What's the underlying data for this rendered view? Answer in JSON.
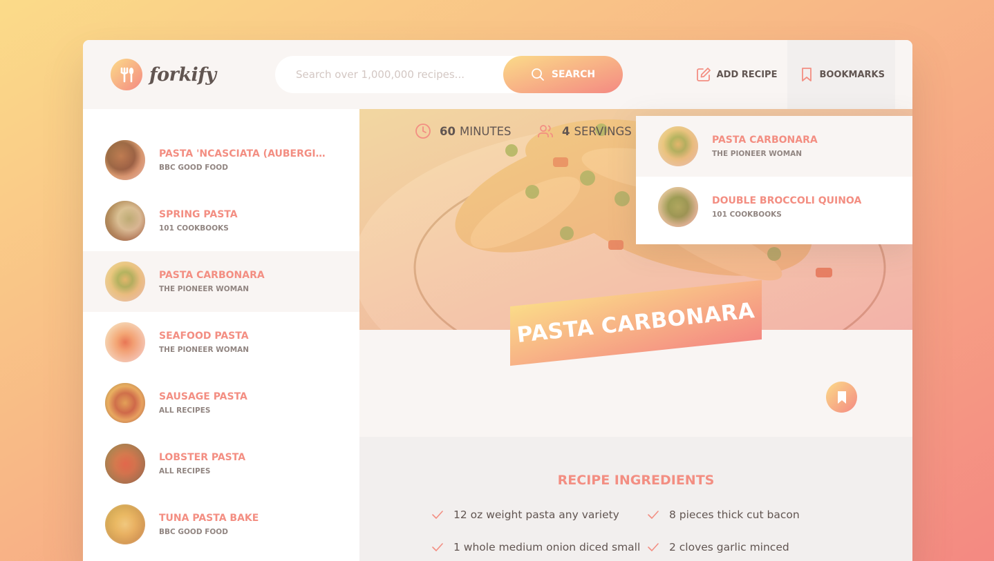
{
  "header": {
    "logo_text": "forkify",
    "search_placeholder": "Search over 1,000,000 recipes...",
    "search_label": "SEARCH",
    "add_recipe_label": "ADD RECIPE",
    "bookmarks_label": "BOOKMARKS"
  },
  "results": [
    {
      "title": "PASTA 'NCASCIATA (AUBERGINE ...",
      "publisher": "BBC GOOD FOOD",
      "active": false
    },
    {
      "title": "SPRING PASTA",
      "publisher": "101 COOKBOOKS",
      "active": false
    },
    {
      "title": "PASTA CARBONARA",
      "publisher": "THE PIONEER WOMAN",
      "active": true
    },
    {
      "title": "SEAFOOD PASTA",
      "publisher": "THE PIONEER WOMAN",
      "active": false
    },
    {
      "title": "SAUSAGE PASTA",
      "publisher": "ALL RECIPES",
      "active": false
    },
    {
      "title": "LOBSTER PASTA",
      "publisher": "ALL RECIPES",
      "active": false
    },
    {
      "title": "TUNA PASTA BAKE",
      "publisher": "BBC GOOD FOOD",
      "active": false
    }
  ],
  "bookmarks": [
    {
      "title": "PASTA CARBONARA",
      "publisher": "THE PIONEER WOMAN"
    },
    {
      "title": "DOUBLE BROCCOLI QUINOA",
      "publisher": "101 COOKBOOKS"
    }
  ],
  "recipe": {
    "title": "PASTA CARBONARA",
    "minutes": "60",
    "minutes_label": "MINUTES",
    "servings": "4",
    "servings_label": "SERVINGS",
    "ingredients_heading": "RECIPE INGREDIENTS",
    "ingredients": [
      "12 oz weight pasta any variety",
      "8 pieces thick cut bacon",
      "1 whole medium onion diced small",
      "2 cloves garlic minced"
    ]
  },
  "colors": {
    "accent": "#f38e82",
    "gradient_start": "#fbdb89",
    "gradient_end": "#f48982",
    "text": "#615551"
  },
  "icons": {
    "logo": "fork-spoon-icon",
    "search": "search-icon",
    "add_recipe": "edit-icon",
    "bookmarks": "bookmark-icon",
    "time": "clock-icon",
    "servings": "users-icon",
    "decrease": "minus-circle-icon",
    "increase": "plus-circle-icon",
    "ingredient": "check-icon"
  }
}
